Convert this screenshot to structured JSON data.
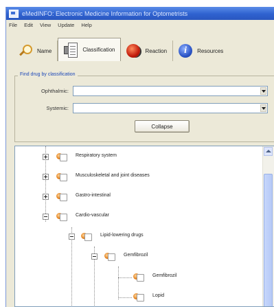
{
  "window": {
    "title": "eMedINFO: Electronic Medicine Information for Optometrists"
  },
  "menu": [
    "File",
    "Edit",
    "View",
    "Update",
    "Help"
  ],
  "toolbar": {
    "tabs": [
      {
        "label": "Name",
        "icon": "search-icon",
        "active": false
      },
      {
        "label": "Classification",
        "icon": "classification-icon",
        "active": true
      },
      {
        "label": "Reaction",
        "icon": "reaction-icon",
        "active": false
      },
      {
        "label": "Resources",
        "icon": "info-icon",
        "active": false
      }
    ]
  },
  "find": {
    "title": "Find drug by classification",
    "ophthalmic_label": "Ophthalmic:",
    "ophthalmic_value": "",
    "systemic_label": "Systemic:",
    "systemic_value": "",
    "collapse_label": "Collapse"
  },
  "tree": {
    "nodes": [
      {
        "label": "Respiratory system",
        "level": 0,
        "state": "collapsed"
      },
      {
        "label": "Musculoskeletal and joint diseases",
        "level": 0,
        "state": "collapsed"
      },
      {
        "label": "Gastro-intestinal",
        "level": 0,
        "state": "collapsed"
      },
      {
        "label": "Cardio-vascular",
        "level": 0,
        "state": "expanded"
      },
      {
        "label": "Lipid-lowering drugs",
        "level": 1,
        "state": "expanded"
      },
      {
        "label": "Gemfibrozil",
        "level": 2,
        "state": "expanded"
      },
      {
        "label": "Gemfibrozil",
        "level": 3,
        "state": "leaf"
      },
      {
        "label": "Lopid",
        "level": 3,
        "state": "leaf"
      }
    ]
  },
  "colors": {
    "titlebar": "#2f62cf",
    "window_bg": "#ece9d8",
    "group_title": "#1b47b8",
    "scroll_thumb": "#b6c9f6"
  }
}
